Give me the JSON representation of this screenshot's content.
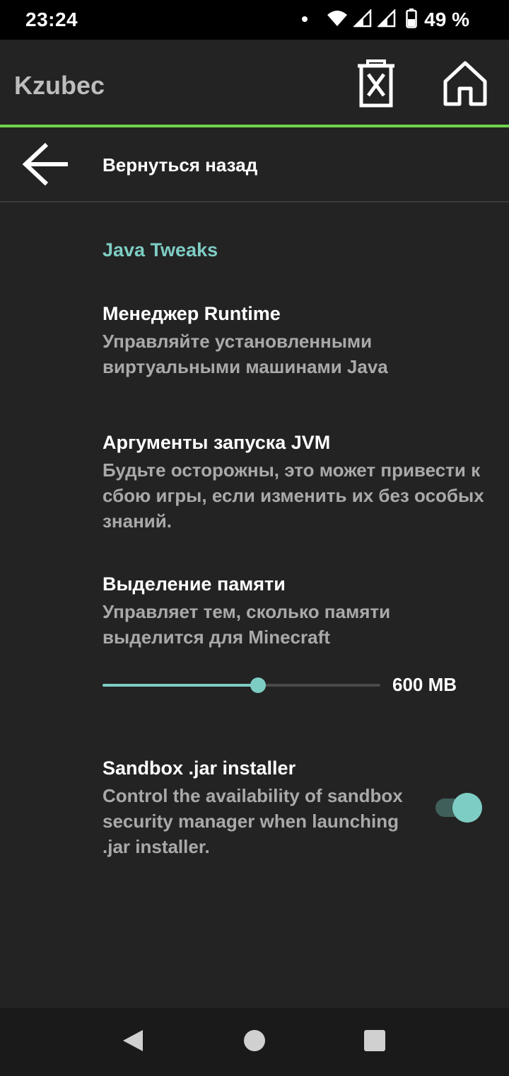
{
  "status_bar": {
    "time": "23:24",
    "battery_percent": "49 %",
    "icons": [
      "dot-icon",
      "wifi-icon",
      "signal-icon",
      "signal-icon",
      "battery-icon"
    ]
  },
  "app_bar": {
    "title": "Kzubec",
    "actions": [
      "delete-icon",
      "home-icon"
    ]
  },
  "back_row": {
    "label": "Вернуться назад",
    "icon": "back-arrow-icon"
  },
  "category": {
    "title": "Java Tweaks"
  },
  "preferences": [
    {
      "title": "Менеджер Runtime",
      "summary": "Управляйте установленными виртуальными машинами Java"
    },
    {
      "title": "Аргументы запуска JVM",
      "summary": "Будьте осторожны, это может привести к сбою игры, если изменить их без особых знаний."
    },
    {
      "title": "Выделение памяти",
      "summary": "Управляет тем, сколько памяти выделится для Minecraft",
      "slider_value": "600 MB",
      "slider_fraction": 0.56
    },
    {
      "title": "Sandbox .jar installer",
      "summary": "Control the availability of sandbox security manager when launching .jar installer.",
      "enabled": true
    }
  ],
  "colors": {
    "accent": "#7ecdc4",
    "accent_line": "#6fd34a",
    "background": "#232323"
  },
  "nav_bar": {
    "buttons": [
      "nav-back-icon",
      "nav-home-icon",
      "nav-recents-icon"
    ]
  }
}
